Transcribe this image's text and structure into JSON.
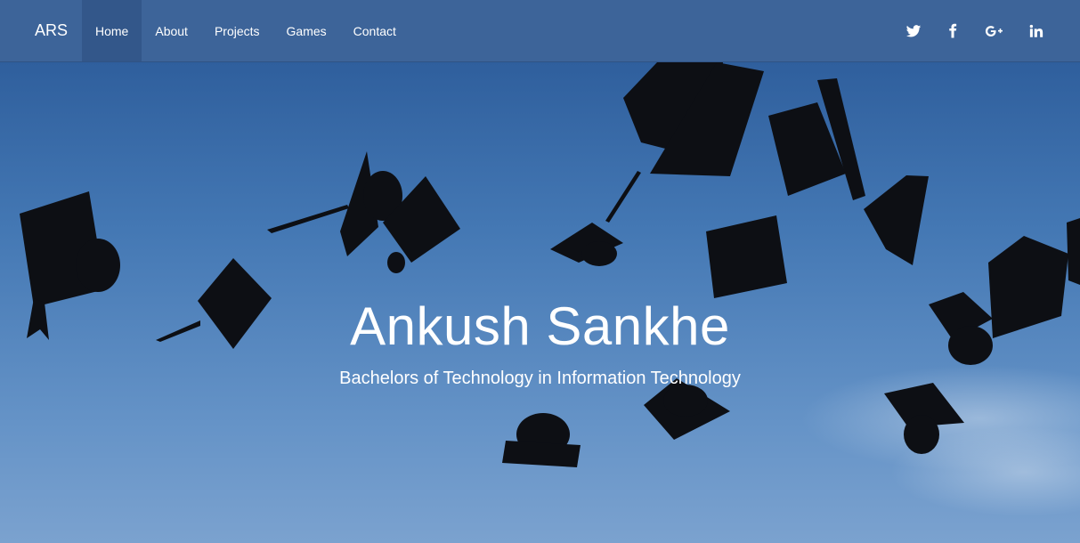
{
  "nav": {
    "brand": "ARS",
    "links": [
      {
        "label": "Home",
        "active": true
      },
      {
        "label": "About",
        "active": false
      },
      {
        "label": "Projects",
        "active": false
      },
      {
        "label": "Games",
        "active": false
      },
      {
        "label": "Contact",
        "active": false
      }
    ],
    "social": [
      "twitter-icon",
      "facebook-icon",
      "google-plus-icon",
      "linkedin-icon"
    ]
  },
  "hero": {
    "title": "Ankush Sankhe",
    "subtitle": "Bachelors of Technology in Information Technology",
    "background": "graduation-caps-in-sky-photo"
  },
  "colors": {
    "navbar": "#3d6499",
    "nav_active": "#33578a",
    "sky": "#5d8ac0",
    "text": "#ffffff"
  }
}
